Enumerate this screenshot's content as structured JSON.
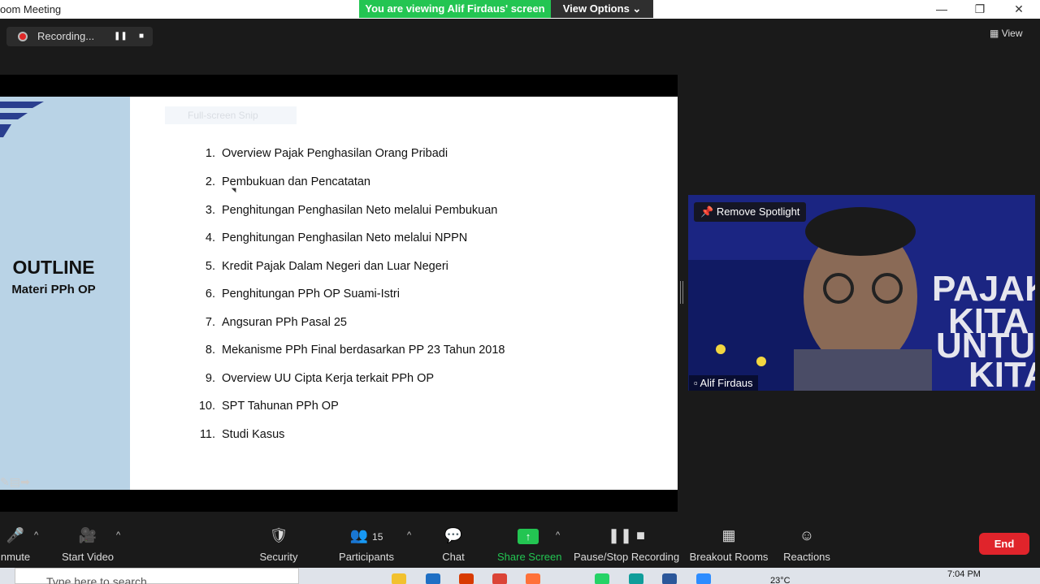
{
  "window": {
    "title": "oom Meeting",
    "viewing_banner": "You are viewing Alif Firdaus' screen",
    "view_options": "View Options ⌄"
  },
  "recording": {
    "label": "Recording..."
  },
  "view_button": "View",
  "slide": {
    "snip_text": "Full-screen Snip",
    "title": "OUTLINE",
    "subtitle": "Materi PPh OP",
    "items": [
      {
        "num": "1.",
        "text": "Overview Pajak Penghasilan Orang Pribadi"
      },
      {
        "num": "2.",
        "text": "Pembukuan dan Pencatatan"
      },
      {
        "num": "3.",
        "text": "Penghitungan Penghasilan Neto melalui Pembukuan"
      },
      {
        "num": "4.",
        "text": "Penghitungan Penghasilan Neto melalui NPPN"
      },
      {
        "num": "5.",
        "text": "Kredit Pajak Dalam Negeri dan Luar Negeri"
      },
      {
        "num": "6.",
        "text": "Penghitungan PPh OP Suami-Istri"
      },
      {
        "num": "7.",
        "text": "Angsuran PPh Pasal 25"
      },
      {
        "num": "8.",
        "text": "Mekanisme PPh Final berdasarkan PP 23 Tahun 2018"
      },
      {
        "num": "9.",
        "text": "Overview UU Cipta Kerja terkait PPh OP"
      },
      {
        "num": "10.",
        "text": "SPT Tahunan PPh OP"
      },
      {
        "num": "11.",
        "text": "Studi Kasus"
      }
    ]
  },
  "video": {
    "spotlight_label": "Remove Spotlight",
    "participant_name": "Alif Firdaus",
    "backdrop_lines": [
      "PAJAK",
      "KITA",
      "UNTUK",
      "KITA"
    ]
  },
  "toolbar": {
    "unmute": "nmute",
    "start_video": "Start Video",
    "security": "Security",
    "participants": "Participants",
    "participant_count": "15",
    "chat": "Chat",
    "share_screen": "Share Screen",
    "pause_stop": "Pause/Stop Recording",
    "breakout": "Breakout Rooms",
    "reactions": "Reactions",
    "end": "End"
  },
  "taskbar": {
    "search_placeholder": "Type here to search",
    "temperature": "23°C",
    "time": "7:04 PM"
  },
  "colors": {
    "banner_green": "#23c552",
    "end_red": "#e0242b",
    "share_green": "#23c552",
    "slide_side": "#b9d3e6"
  }
}
